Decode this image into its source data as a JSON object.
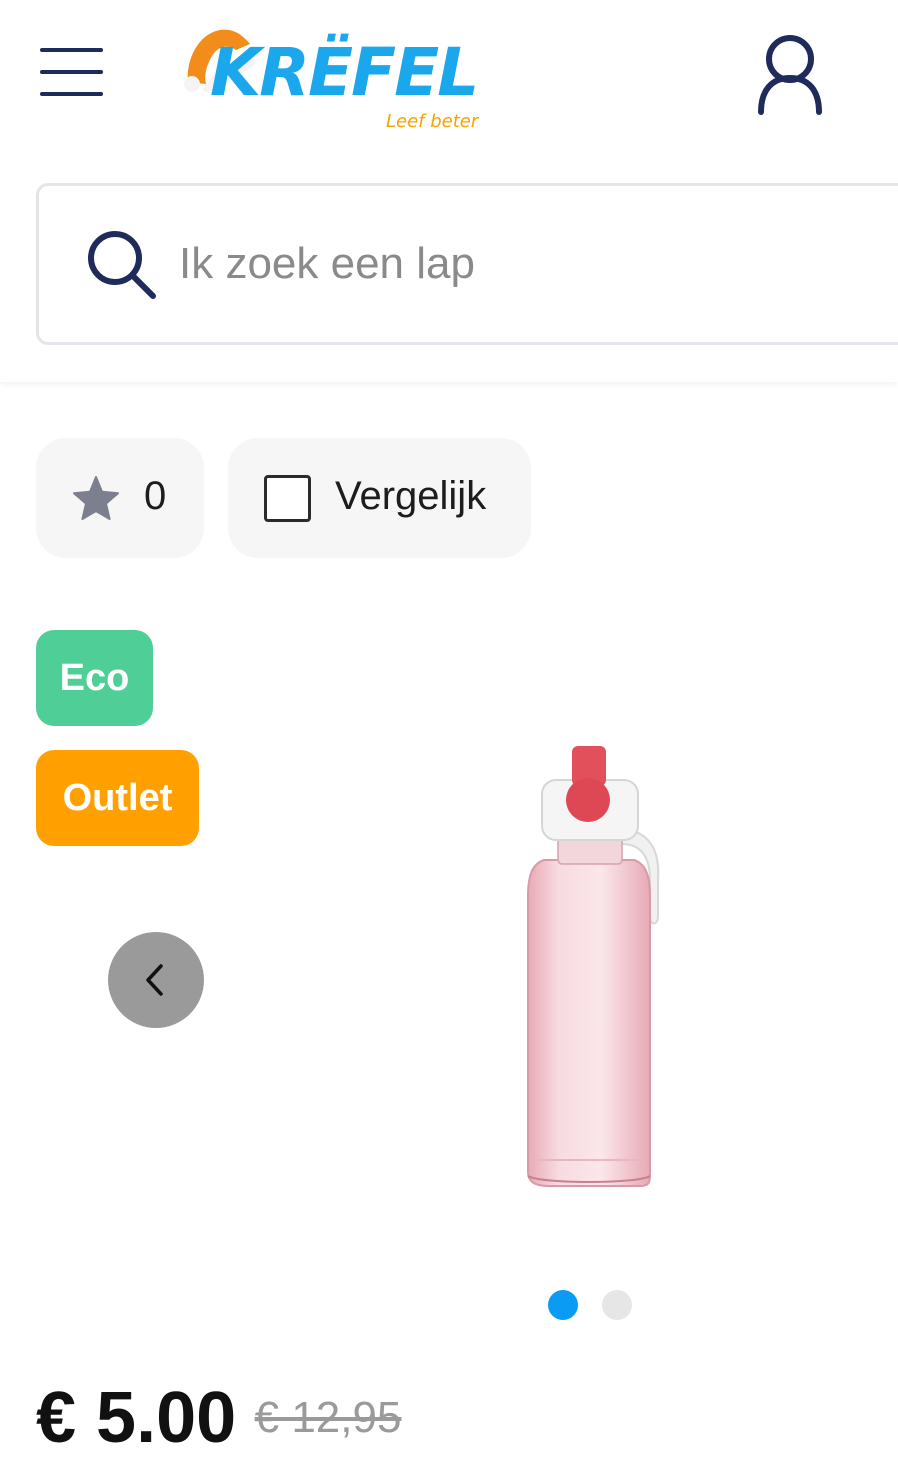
{
  "header": {
    "logo": {
      "brand": "KRËFEL",
      "tagline": "Leef beter"
    }
  },
  "search": {
    "placeholder": "Ik zoek een lap"
  },
  "actions": {
    "favorites_count": "0",
    "compare_label": "Vergelijk"
  },
  "badges": {
    "eco": "Eco",
    "outlet": "Outlet"
  },
  "gallery": {
    "total_images": 2,
    "active_index": 1
  },
  "price": {
    "current": "€ 5.00",
    "old": "€ 12,95"
  },
  "colors": {
    "brand_blue": "#1aa7ec",
    "brand_orange": "#f5a400",
    "navy": "#1f2b5b",
    "eco_green": "#4fcf97",
    "outlet_orange": "#ffa000",
    "dot_active": "#0a9cf5"
  },
  "icons": {
    "menu": "hamburger-icon",
    "account": "user-icon",
    "search": "search-icon",
    "favorite": "star-icon",
    "prev": "chevron-left-icon"
  }
}
